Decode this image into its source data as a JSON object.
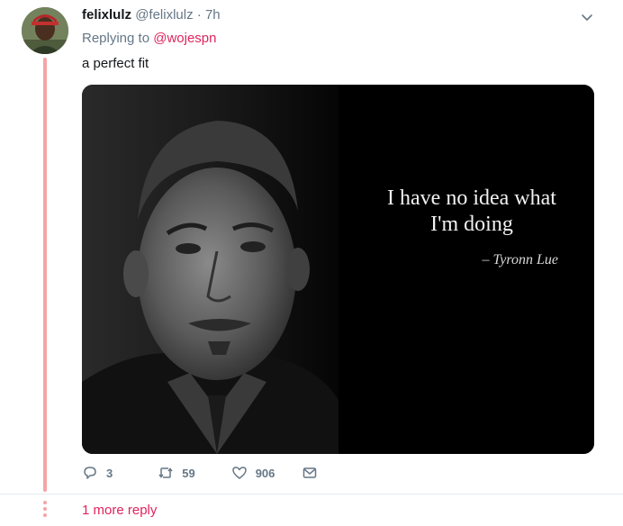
{
  "tweet": {
    "name": "felixlulz",
    "handle": "@felixlulz",
    "separator": "·",
    "time": "7h",
    "replying_prefix": "Replying to",
    "replying_to": "@wojespn",
    "text": "a perfect fit",
    "image": {
      "quote_line1": "I have no idea what",
      "quote_line2": "I'm doing",
      "attribution": "– Tyronn Lue"
    },
    "actions": {
      "replies": "3",
      "retweets": "59",
      "likes": "906"
    }
  },
  "thread": {
    "more_reply": "1 more reply"
  },
  "colors": {
    "accent": "#e0245e",
    "thread_line": "#f6a4a7",
    "muted": "#657786"
  }
}
